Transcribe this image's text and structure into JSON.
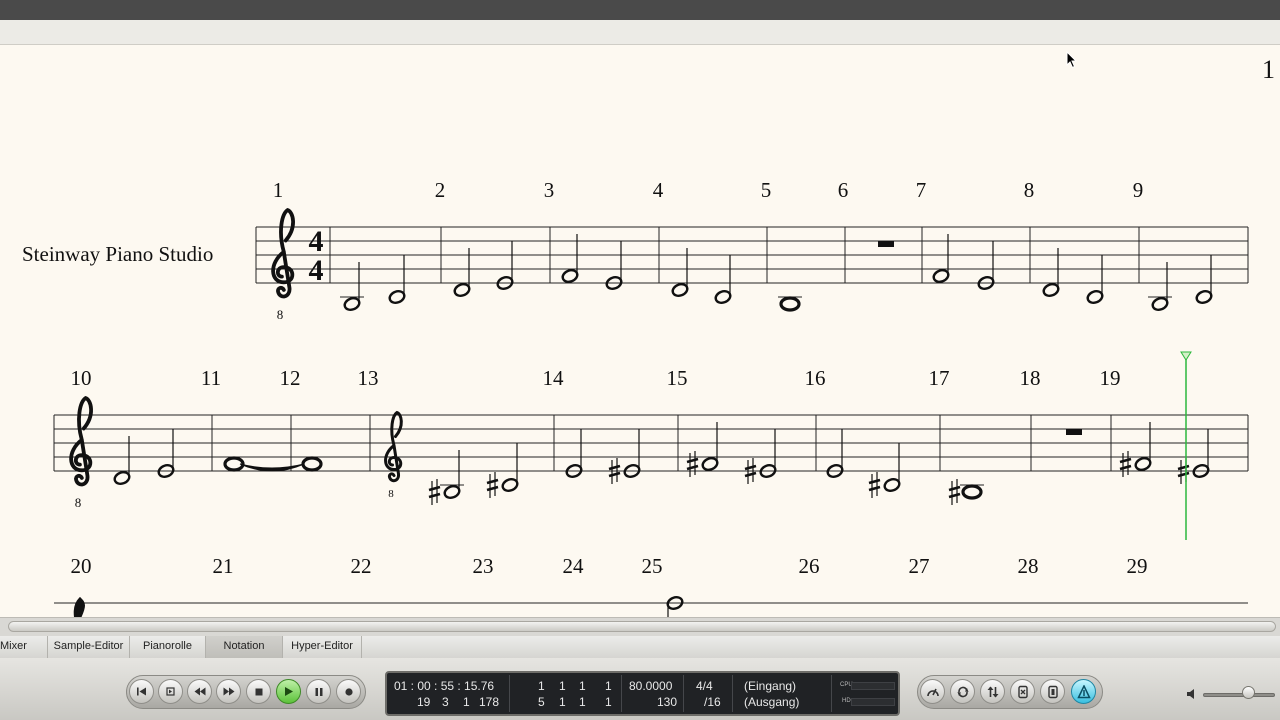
{
  "page": {
    "number": "1"
  },
  "score": {
    "track_name": "Steinway Piano Studio",
    "time_signature": {
      "top": "4",
      "bottom": "4"
    },
    "clef_octave": "8",
    "systems": [
      {
        "measures": [
          "1",
          "2",
          "3",
          "4",
          "5",
          "6",
          "7",
          "8",
          "9"
        ]
      },
      {
        "measures": [
          "10",
          "11",
          "12",
          "13",
          "14",
          "15",
          "16",
          "17",
          "18",
          "19"
        ]
      },
      {
        "measures": [
          "20",
          "21",
          "22",
          "23",
          "24",
          "25",
          "26",
          "27",
          "28",
          "29"
        ]
      }
    ]
  },
  "tabs": [
    {
      "label": "Mixer",
      "active": false
    },
    {
      "label": "Sample-Editor",
      "active": false
    },
    {
      "label": "Pianorolle",
      "active": false
    },
    {
      "label": "Notation",
      "active": true
    },
    {
      "label": "Hyper-Editor",
      "active": false
    }
  ],
  "transport": {
    "buttons": [
      "go-to-start",
      "go-to-end",
      "rewind",
      "fast-forward",
      "stop",
      "play",
      "pause",
      "record"
    ],
    "smpte": "01 : 00 : 55 : 15.76",
    "bar_position": [
      "19",
      "3",
      "1",
      "178"
    ],
    "locator_left": [
      "1",
      "1",
      "1",
      "1"
    ],
    "locator_right": [
      "5",
      "1",
      "1",
      "1"
    ],
    "tempo": "80.0000",
    "tempo_sub": "130",
    "signature": "4/4",
    "division": "/16",
    "input": "(Eingang)",
    "output": "(Ausgang)",
    "cpu_label": "CPU",
    "hd_label": "HD",
    "right_buttons": [
      "metronome",
      "cycle",
      "replace",
      "solo",
      "sync",
      "tuner"
    ]
  },
  "volume": {
    "level": 0.68
  },
  "colors": {
    "playhead": "#2db83d",
    "page": "#fdf9f1",
    "lcd": "#202225"
  }
}
